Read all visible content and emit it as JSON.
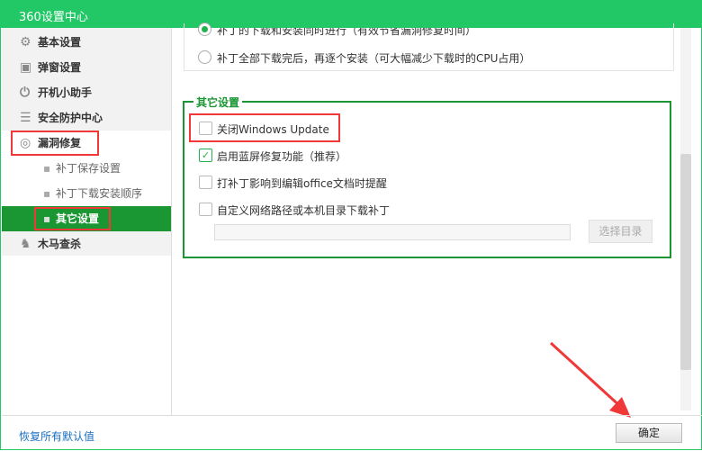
{
  "window": {
    "title": "360设置中心",
    "close_icon": "close-icon"
  },
  "sidebar": {
    "items": [
      {
        "label": "基本设置",
        "icon": "gear-icon"
      },
      {
        "label": "弹窗设置",
        "icon": "window-icon"
      },
      {
        "label": "开机小助手",
        "icon": "power-icon"
      },
      {
        "label": "安全防护中心",
        "icon": "shield-icon"
      },
      {
        "label": "漏洞修复",
        "icon": "repair-icon"
      },
      {
        "label": "木马查杀",
        "icon": "horse-icon"
      }
    ],
    "subitems": [
      {
        "label": "补丁保存设置"
      },
      {
        "label": "补丁下载安装顺序"
      },
      {
        "label": "其它设置",
        "active": true
      }
    ]
  },
  "install_order": {
    "options": [
      {
        "label": "补丁的下载和安装同时进行（有效节省漏洞修复时间）",
        "selected": true
      },
      {
        "label": "补丁全部下载完后，再逐个安装（可大幅减少下载时的CPU占用）",
        "selected": false
      }
    ]
  },
  "other_settings": {
    "title": "其它设置",
    "options": [
      {
        "label": "关闭Windows Update",
        "checked": false
      },
      {
        "label": "启用蓝屏修复功能（推荐）",
        "checked": true
      },
      {
        "label": "打补丁影响到编辑office文档时提醒",
        "checked": false
      },
      {
        "label": "自定义网络路径或本机目录下载补丁",
        "checked": false
      }
    ],
    "path_value": "",
    "choose_dir_label": "选择目录"
  },
  "footer": {
    "reset_label": "恢复所有默认值",
    "ok_label": "确定"
  },
  "colors": {
    "brand": "#22c866",
    "active": "#1a9632",
    "highlight": "#f03838"
  }
}
